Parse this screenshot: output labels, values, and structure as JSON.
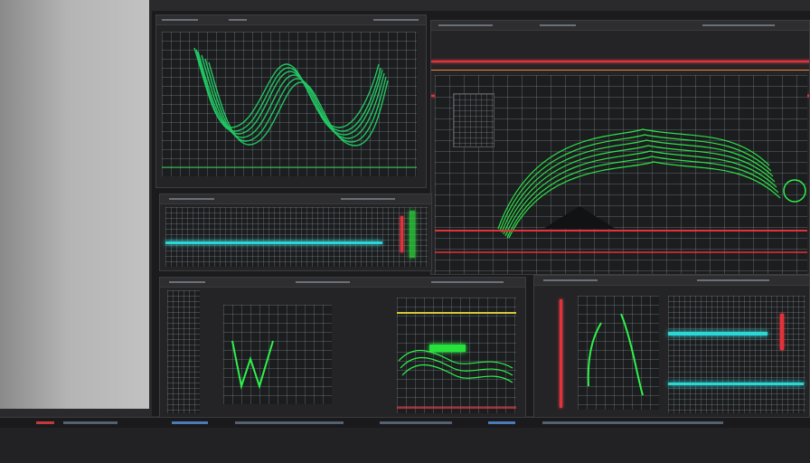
{
  "windows": [
    {
      "id": "pane-waveform-top-left"
    },
    {
      "id": "pane-spectrum-main"
    },
    {
      "id": "pane-timeline-middle"
    },
    {
      "id": "pane-analysis-bottom-left"
    },
    {
      "id": "pane-meters-bottom-right"
    }
  ],
  "colors": {
    "signal": "#27e23a",
    "signal_alt": "#2ad7d6",
    "marker": "#e4323a",
    "background": "#2a2a2c",
    "panel": "#242426"
  }
}
